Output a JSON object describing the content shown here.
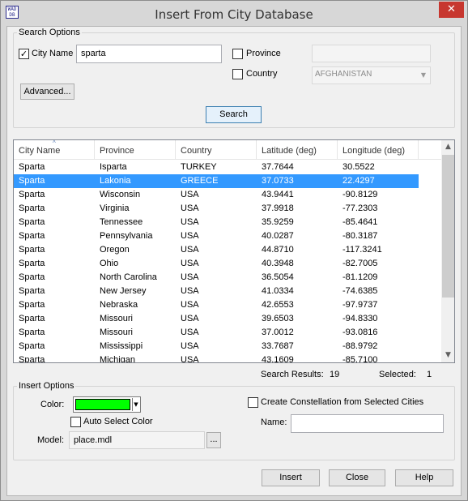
{
  "window": {
    "title": "Insert From City Database",
    "icon_text": "WAD DB",
    "close_glyph": "✕"
  },
  "search_options": {
    "group_label": "Search Options",
    "city_name": {
      "label": "City Name",
      "checked": true,
      "value": "sparta"
    },
    "province": {
      "label": "Province",
      "checked": false,
      "value": ""
    },
    "country": {
      "label": "Country",
      "checked": false,
      "value": "AFGHANISTAN"
    },
    "advanced_label": "Advanced...",
    "search_label": "Search"
  },
  "results": {
    "columns": [
      "City Name",
      "Province",
      "Country",
      "Latitude (deg)",
      "Longitude (deg)"
    ],
    "sorted_column": "City Name",
    "selected_index": 1,
    "rows": [
      [
        "Sparta",
        "Isparta",
        "TURKEY",
        "37.7644",
        "30.5522"
      ],
      [
        "Sparta",
        "Lakonia",
        "GREECE",
        "37.0733",
        "22.4297"
      ],
      [
        "Sparta",
        "Wisconsin",
        "USA",
        "43.9441",
        "-90.8129"
      ],
      [
        "Sparta",
        "Virginia",
        "USA",
        "37.9918",
        "-77.2303"
      ],
      [
        "Sparta",
        "Tennessee",
        "USA",
        "35.9259",
        "-85.4641"
      ],
      [
        "Sparta",
        "Pennsylvania",
        "USA",
        "40.0287",
        "-80.3187"
      ],
      [
        "Sparta",
        "Oregon",
        "USA",
        "44.8710",
        "-117.3241"
      ],
      [
        "Sparta",
        "Ohio",
        "USA",
        "40.3948",
        "-82.7005"
      ],
      [
        "Sparta",
        "North Carolina",
        "USA",
        "36.5054",
        "-81.1209"
      ],
      [
        "Sparta",
        "New Jersey",
        "USA",
        "41.0334",
        "-74.6385"
      ],
      [
        "Sparta",
        "Nebraska",
        "USA",
        "42.6553",
        "-97.9737"
      ],
      [
        "Sparta",
        "Missouri",
        "USA",
        "39.6503",
        "-94.8330"
      ],
      [
        "Sparta",
        "Missouri",
        "USA",
        "37.0012",
        "-93.0816"
      ],
      [
        "Sparta",
        "Mississippi",
        "USA",
        "33.7687",
        "-88.9792"
      ],
      [
        "Sparta",
        "Michigan",
        "USA",
        "43.1609",
        "-85.7100"
      ]
    ],
    "search_results_label": "Search Results:",
    "search_results_count": "19",
    "selected_label": "Selected:",
    "selected_count": "1"
  },
  "insert_options": {
    "group_label": "Insert Options",
    "color_label": "Color:",
    "color_value": "#00ff00",
    "auto_select_label": "Auto Select Color",
    "auto_select_checked": false,
    "model_label": "Model:",
    "model_value": "place.mdl",
    "browse_label": "...",
    "constellation_label": "Create Constellation from Selected Cities",
    "constellation_checked": false,
    "name_label": "Name:",
    "name_value": ""
  },
  "buttons": {
    "insert": "Insert",
    "close": "Close",
    "help": "Help"
  },
  "colors": {
    "selection": "#3399ff",
    "close_button": "#c7372f"
  }
}
